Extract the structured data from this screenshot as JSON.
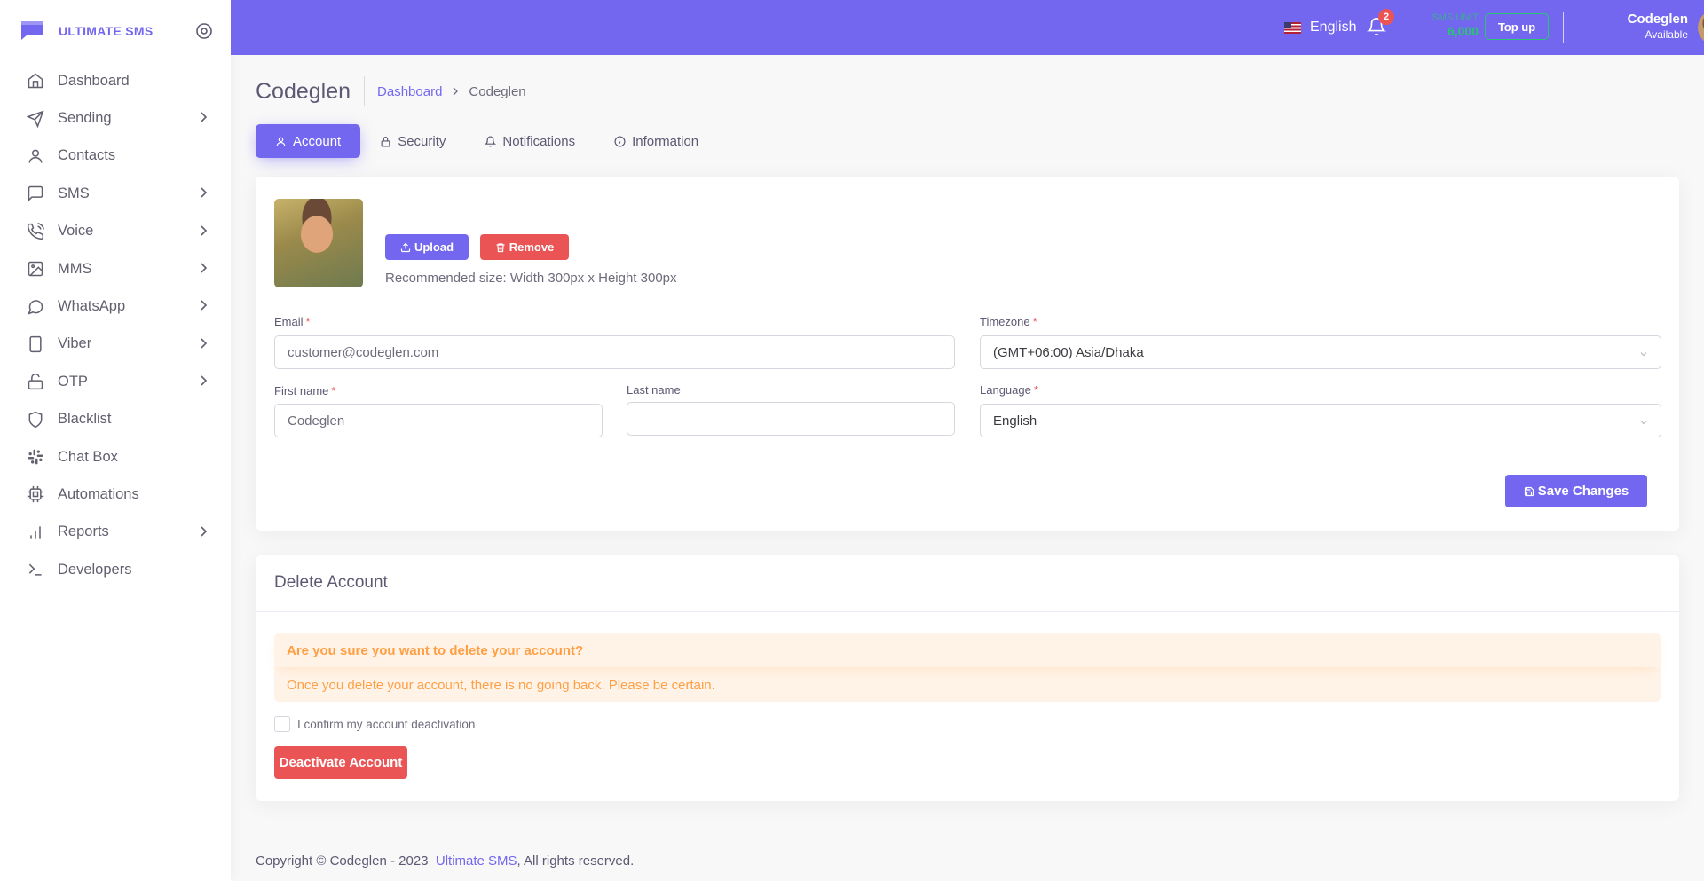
{
  "brand": {
    "name": "ULTIMATE SMS"
  },
  "sidebar": {
    "items": [
      {
        "label": "Dashboard",
        "icon": "home-icon",
        "has_children": false
      },
      {
        "label": "Sending",
        "icon": "send-icon",
        "has_children": true
      },
      {
        "label": "Contacts",
        "icon": "user-icon",
        "has_children": false
      },
      {
        "label": "SMS",
        "icon": "message-square-icon",
        "has_children": true
      },
      {
        "label": "Voice",
        "icon": "phone-call-icon",
        "has_children": true
      },
      {
        "label": "MMS",
        "icon": "image-icon",
        "has_children": true
      },
      {
        "label": "WhatsApp",
        "icon": "message-circle-icon",
        "has_children": true
      },
      {
        "label": "Viber",
        "icon": "tablet-icon",
        "has_children": true
      },
      {
        "label": "OTP",
        "icon": "unlock-icon",
        "has_children": true
      },
      {
        "label": "Blacklist",
        "icon": "shield-icon",
        "has_children": false
      },
      {
        "label": "Chat Box",
        "icon": "slack-icon",
        "has_children": false
      },
      {
        "label": "Automations",
        "icon": "cpu-icon",
        "has_children": false
      },
      {
        "label": "Reports",
        "icon": "bar-chart-icon",
        "has_children": true
      },
      {
        "label": "Developers",
        "icon": "terminal-icon",
        "has_children": false
      }
    ]
  },
  "topbar": {
    "language": "English",
    "notification_count": "2",
    "sms_unit_label": "SMS UNIT",
    "sms_unit_value": "6,000",
    "topup_label": "Top up",
    "user_name": "Codeglen",
    "user_status": "Available"
  },
  "page": {
    "title": "Codeglen",
    "breadcrumb": {
      "link": "Dashboard",
      "current": "Codeglen"
    }
  },
  "tabs": [
    {
      "label": "Account",
      "icon": "user-icon",
      "active": true
    },
    {
      "label": "Security",
      "icon": "lock-icon",
      "active": false
    },
    {
      "label": "Notifications",
      "icon": "bell-icon",
      "active": false
    },
    {
      "label": "Information",
      "icon": "info-icon",
      "active": false
    }
  ],
  "account": {
    "upload_label": "Upload",
    "remove_label": "Remove",
    "recommended": "Recommended size: Width 300px x Height 300px",
    "email_label": "Email",
    "email_value": "customer@codeglen.com",
    "timezone_label": "Timezone",
    "timezone_value": "(GMT+06:00) Asia/Dhaka",
    "first_name_label": "First name",
    "first_name_value": "Codeglen",
    "last_name_label": "Last name",
    "last_name_value": "",
    "language_label": "Language",
    "language_value": "English",
    "save_label": "Save Changes"
  },
  "delete_account": {
    "title": "Delete Account",
    "alert_heading": "Are you sure you want to delete your account?",
    "alert_body": "Once you delete your account, there is no going back. Please be certain.",
    "confirm_label": "I confirm my account deactivation",
    "deactivate_label": "Deactivate Account"
  },
  "footer": {
    "prefix": "Copyright © Codeglen - 2023",
    "link": "Ultimate SMS",
    "suffix": ", All rights reserved."
  },
  "colors": {
    "primary": "#7367f0",
    "danger": "#ea5455",
    "warning": "#ff9f43",
    "success": "#28c76f"
  }
}
